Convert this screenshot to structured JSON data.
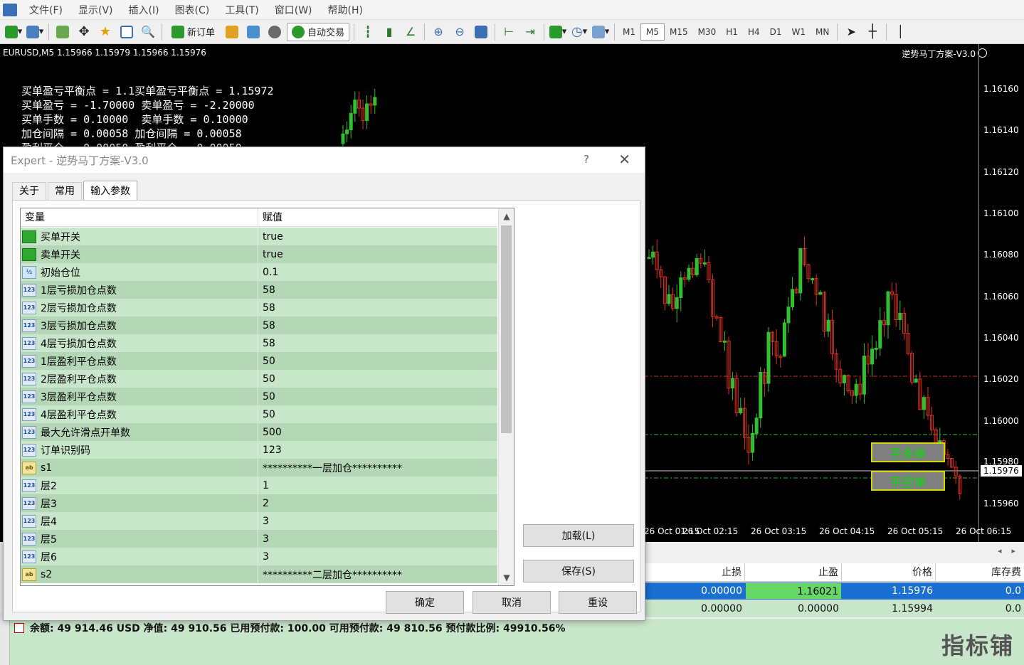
{
  "menu": [
    "文件(F)",
    "显示(V)",
    "插入(I)",
    "图表(C)",
    "工具(T)",
    "窗口(W)",
    "帮助(H)"
  ],
  "toolbar": {
    "new_order": "新订单",
    "auto_trading": "自动交易",
    "timeframes": [
      "M1",
      "M5",
      "M15",
      "M30",
      "H1",
      "H4",
      "D1",
      "W1",
      "MN"
    ],
    "active_tf": "M5"
  },
  "chart": {
    "symbol_line": "EURUSD,M5  1.15966 1.15979 1.15966 1.15976",
    "ea_title": "逆势马丁方案-V3.0",
    "info_lines": [
      "买单盈亏平衡点 = 1.1买单盈亏平衡点 = 1.15972",
      "买单盈亏 = -1.70000 卖单盈亏 = -2.20000",
      "买单手数 = 0.10000  卖单手数 = 0.10000",
      "加仓间隔 = 0.00058 加仓间隔 = 0.00058",
      "盈利平仓 = 0.00050 盈利平仓 = 0.00050"
    ],
    "price_labels": [
      "1.16160",
      "1.16140",
      "1.16120",
      "1.16100",
      "1.16080",
      "1.16060",
      "1.16040",
      "1.16020",
      "1.16000",
      "1.15980",
      "1.15960"
    ],
    "current_price": "1.15976",
    "time_labels": [
      "26 Oct 01:15",
      "26 Oct 02:15",
      "26 Oct 03:15",
      "26 Oct 04:15",
      "26 Oct 05:15",
      "26 Oct 06:15"
    ],
    "close_buy_label": "平多单",
    "close_sell_label": "平空单"
  },
  "terminal": {
    "headers": [
      "止损",
      "止盈",
      "价格",
      "库存费"
    ],
    "rows": [
      [
        "0.00000",
        "1.16021",
        "1.15976",
        "0.0"
      ],
      [
        "0.00000",
        "0.00000",
        "1.15994",
        "0.0"
      ]
    ],
    "balance_text": "余额: 49 914.46 USD  净值: 49 910.56  已用预付款: 100.00  可用预付款: 49 810.56  预付款比例: 49910.56%"
  },
  "watermark": "指标铺",
  "dialog": {
    "title": "Expert - 逆势马丁方案-V3.0",
    "help": "?",
    "tabs": [
      "关于",
      "常用",
      "输入参数"
    ],
    "active_tab": "输入参数",
    "col_variable": "变量",
    "col_value": "赋值",
    "params": [
      {
        "icon": "bool",
        "icon_text": "",
        "name": "买单开关",
        "value": "true"
      },
      {
        "icon": "bool",
        "icon_text": "",
        "name": "卖单开关",
        "value": "true"
      },
      {
        "icon": "half",
        "icon_text": "½",
        "name": "初始仓位",
        "value": "0.1"
      },
      {
        "icon": "int",
        "icon_text": "123",
        "name": "1层亏损加仓点数",
        "value": "58"
      },
      {
        "icon": "int",
        "icon_text": "123",
        "name": "2层亏损加仓点数",
        "value": "58"
      },
      {
        "icon": "int",
        "icon_text": "123",
        "name": "3层亏损加仓点数",
        "value": "58"
      },
      {
        "icon": "int",
        "icon_text": "123",
        "name": "4层亏损加仓点数",
        "value": "58"
      },
      {
        "icon": "int",
        "icon_text": "123",
        "name": "1层盈利平仓点数",
        "value": "50"
      },
      {
        "icon": "int",
        "icon_text": "123",
        "name": "2层盈利平仓点数",
        "value": "50"
      },
      {
        "icon": "int",
        "icon_text": "123",
        "name": "3层盈利平仓点数",
        "value": "50"
      },
      {
        "icon": "int",
        "icon_text": "123",
        "name": "4层盈利平仓点数",
        "value": "50"
      },
      {
        "icon": "int",
        "icon_text": "123",
        "name": "最大允许滑点开单数",
        "value": "500"
      },
      {
        "icon": "int",
        "icon_text": "123",
        "name": "订单识别码",
        "value": "123"
      },
      {
        "icon": "str",
        "icon_text": "ab",
        "name": "s1",
        "value": "**********一层加仓**********"
      },
      {
        "icon": "int",
        "icon_text": "123",
        "name": "层2",
        "value": "1"
      },
      {
        "icon": "int",
        "icon_text": "123",
        "name": "层3",
        "value": "2"
      },
      {
        "icon": "int",
        "icon_text": "123",
        "name": "层4",
        "value": "3"
      },
      {
        "icon": "int",
        "icon_text": "123",
        "name": "层5",
        "value": "3"
      },
      {
        "icon": "int",
        "icon_text": "123",
        "name": "层6",
        "value": "3"
      },
      {
        "icon": "str",
        "icon_text": "ab",
        "name": "s2",
        "value": "**********二层加仓**********"
      }
    ],
    "load_label": "加载(L)",
    "save_label": "保存(S)",
    "ok_label": "确定",
    "cancel_label": "取消",
    "reset_label": "重设"
  }
}
